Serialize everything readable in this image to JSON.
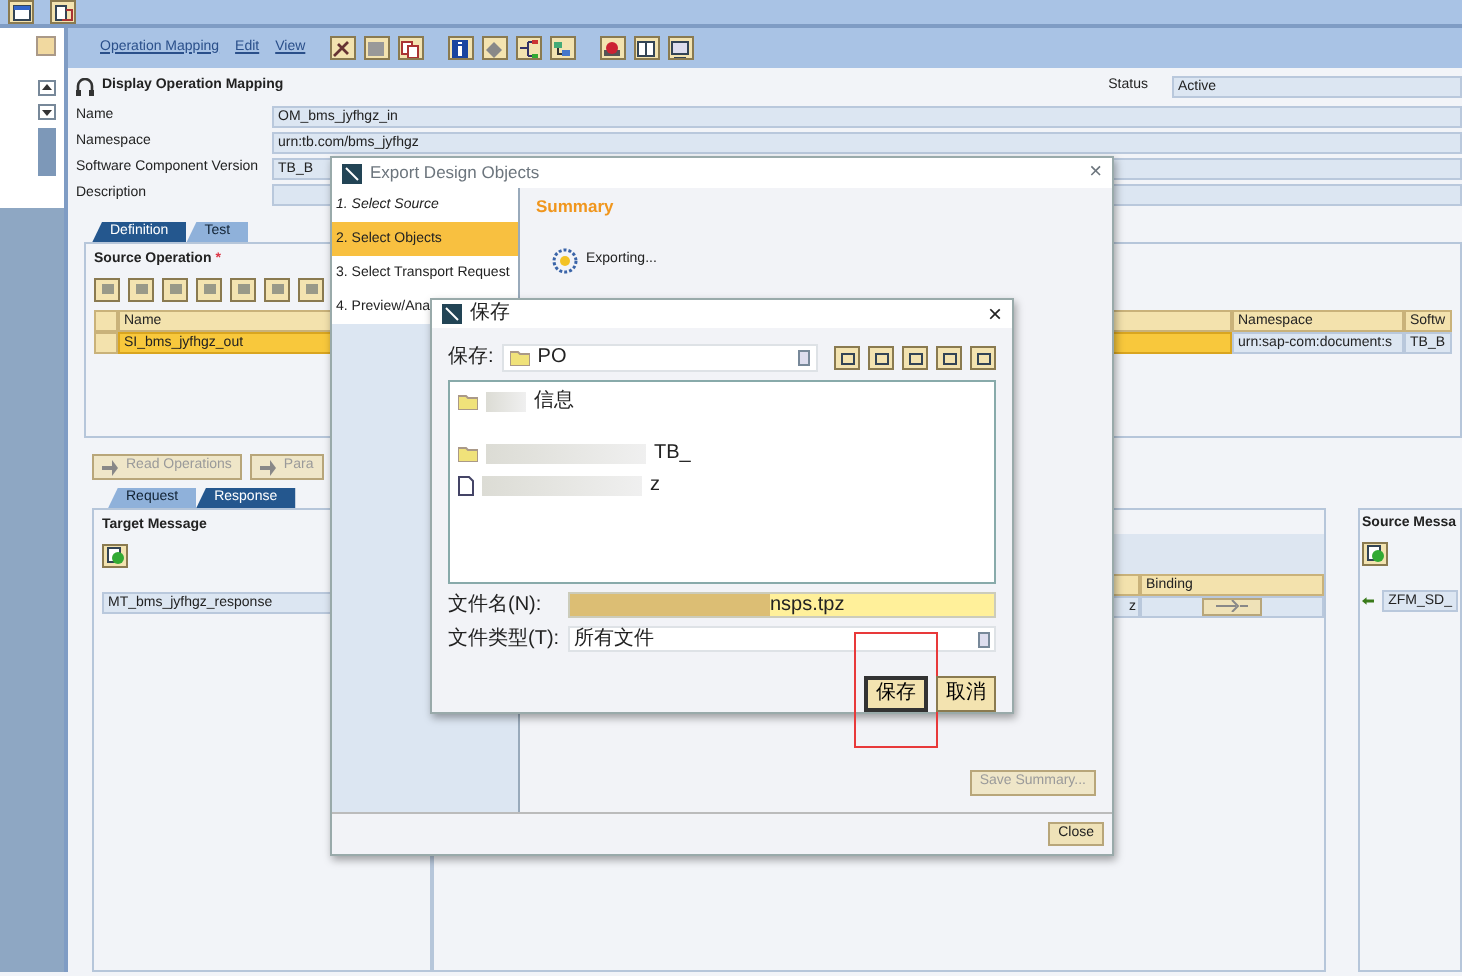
{
  "menu": [
    {
      "label": "Operation Mapping"
    },
    {
      "label": "Edit"
    },
    {
      "label": "View"
    }
  ],
  "header": {
    "title": "Display Operation Mapping",
    "status_label": "Status",
    "status": "Active"
  },
  "fields": [
    {
      "label": "Name",
      "value": "OM_bms_jyfhgz_in"
    },
    {
      "label": "Namespace",
      "value": "urn:tb.com/bms_jyfhgz"
    },
    {
      "label": "Software Component Version",
      "value": "TB_B"
    },
    {
      "label": "Description"
    }
  ],
  "tabs": [
    {
      "label": "Definition",
      "selected": true
    },
    {
      "label": "Test",
      "selected": false
    }
  ],
  "source_operation": {
    "title": "Source Operation",
    "required_mark": "*",
    "columns": [
      "Name",
      "Namespace",
      "Softw"
    ],
    "rows": [
      {
        "cells": [
          "SI_bms_jyfhgz_out",
          "urn:sap-com:document:s",
          "TB_B"
        ],
        "selected": true
      }
    ]
  },
  "operation_buttons": [
    {
      "label": "Read Operations",
      "disabled": true
    },
    {
      "label": "Para",
      "disabled": true
    }
  ],
  "message_tabs": [
    {
      "label": "Request",
      "selected": false
    },
    {
      "label": "Response",
      "selected": true
    }
  ],
  "target_message": {
    "title": "Target Message",
    "value": "MT_bms_jyfhgz_response"
  },
  "binding_table": {
    "column": "Binding",
    "row_text": "z"
  },
  "source_message": {
    "title": "Source Messa",
    "value": "ZFM_SD_"
  },
  "export_dialog": {
    "title": "Export Design Objects",
    "close_label": "×",
    "heading": "Summary",
    "progress_text": "Exporting...",
    "steps": [
      {
        "label": "1. Select Source",
        "selected": false,
        "done": true
      },
      {
        "label": "2. Select Objects",
        "selected": true,
        "done": false
      },
      {
        "label": "3. Select Transport Request",
        "selected": false,
        "done": false
      },
      {
        "label": "4. Preview/Ana",
        "selected": false,
        "done": false
      }
    ],
    "buttons": [
      {
        "label": "Save Summary...",
        "disabled": true
      },
      {
        "label": "Close",
        "disabled": false
      }
    ]
  },
  "save_dialog": {
    "title": "保存",
    "close_label": "×",
    "look_in_label": "保存:",
    "folder": "PO",
    "files": [
      {
        "kind": "folder",
        "name": "信息"
      },
      {
        "kind": "folder",
        "name": "TB_"
      },
      {
        "kind": "file",
        "name": "z"
      }
    ],
    "file_name_label": "文件名(N):",
    "file_name": "nsps.tpz",
    "file_type_label": "文件类型(T):",
    "file_type": "所有文件",
    "buttons": [
      {
        "label": "保存",
        "default": true,
        "highlighted": true
      },
      {
        "label": "取消",
        "default": false,
        "highlighted": false
      }
    ]
  }
}
